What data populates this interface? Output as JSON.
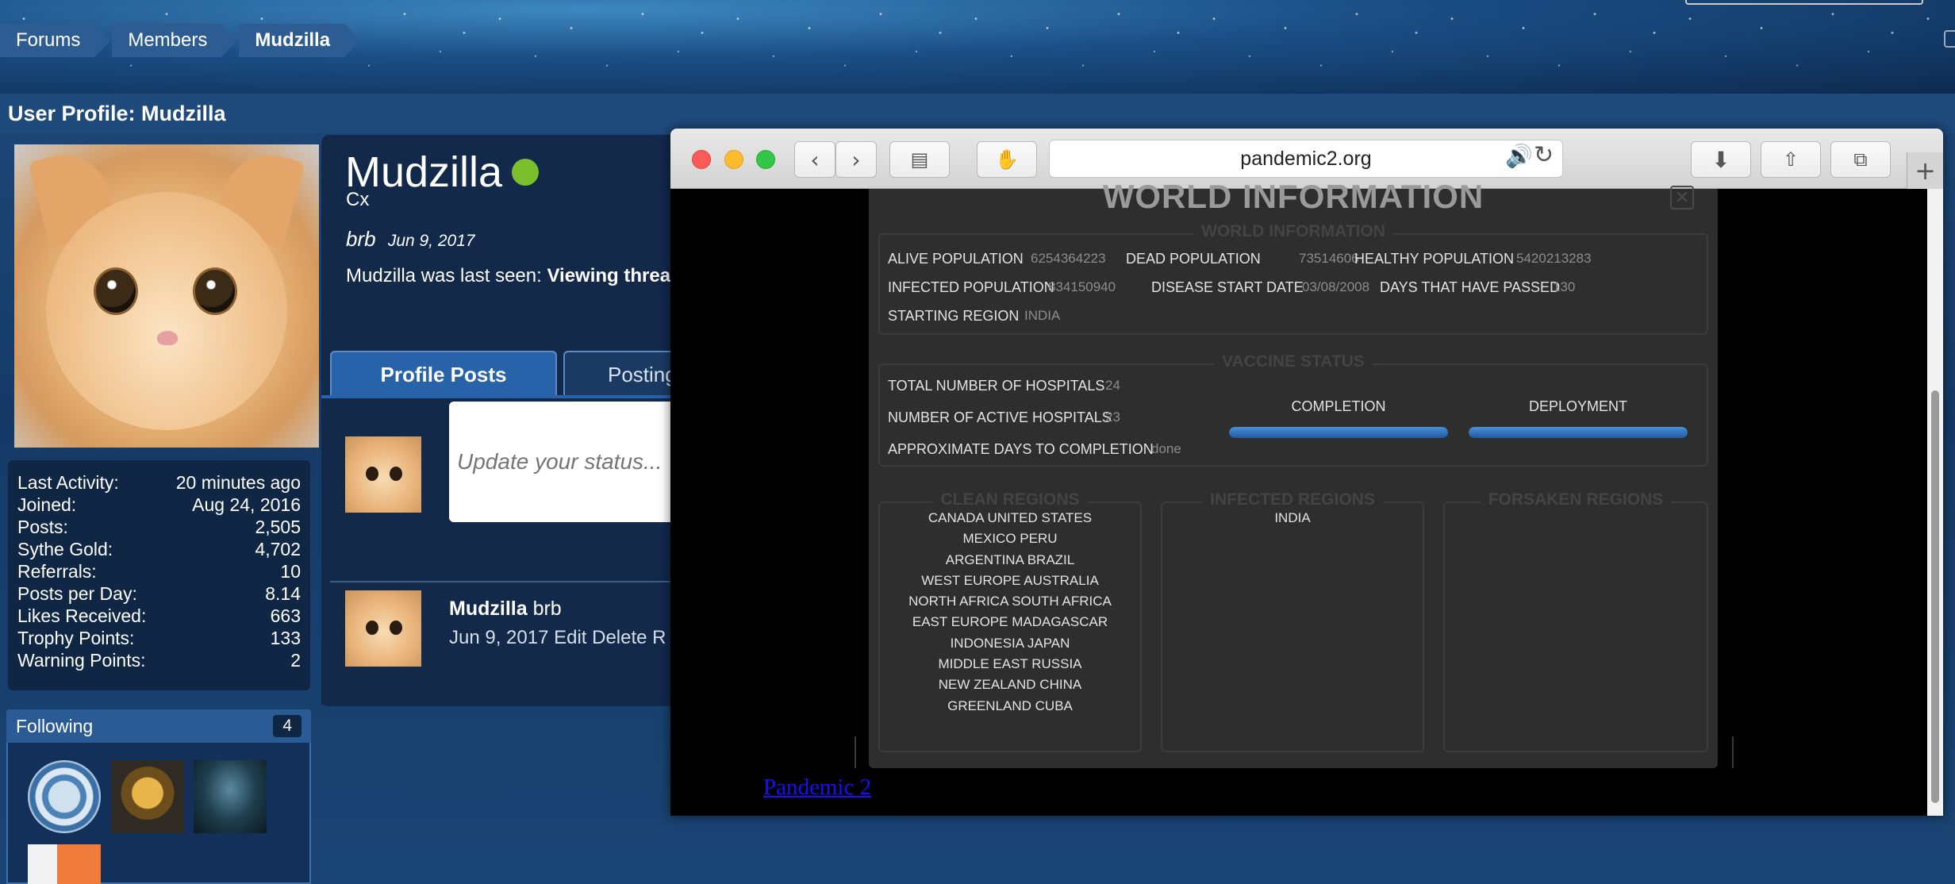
{
  "breadcrumb": [
    "Forums",
    "Members",
    "Mudzilla"
  ],
  "section_title": "User Profile: Mudzilla",
  "profile": {
    "username": "Mudzilla",
    "user_title": "Cx",
    "status_text": "brb",
    "status_date": "Jun 9, 2017",
    "last_seen_prefix": "Mudzilla was last seen:",
    "last_seen_value": "Viewing threa",
    "online_color": "#7cbf2d"
  },
  "stats": [
    {
      "label": "Last Activity:",
      "value": "20 minutes ago"
    },
    {
      "label": "Joined:",
      "value": "Aug 24, 2016"
    },
    {
      "label": "Posts:",
      "value": "2,505"
    },
    {
      "label": "Sythe Gold:",
      "value": "4,702"
    },
    {
      "label": "Referrals:",
      "value": "10"
    },
    {
      "label": "Posts per Day:",
      "value": "8.14"
    },
    {
      "label": "Likes Received:",
      "value": "663"
    },
    {
      "label": "Trophy Points:",
      "value": "133"
    },
    {
      "label": "Warning Points:",
      "value": "2"
    }
  ],
  "following": {
    "label": "Following",
    "count": "4"
  },
  "tabs": {
    "profile_posts": "Profile Posts",
    "postings": "Posting"
  },
  "status_input": {
    "placeholder": "Update your status..."
  },
  "post": {
    "author": "Mudzilla",
    "text": "brb",
    "meta": "Jun 9, 2017 Edit Delete R"
  },
  "browser": {
    "url": "pandemic2.org"
  },
  "game": {
    "title": "WORLD INFORMATION",
    "world_legend": "WORLD INFORMATION",
    "alive_label": "ALIVE POPULATION",
    "alive_value": "6254364223",
    "dead_label": "DEAD POPULATION",
    "dead_value": "73514606",
    "healthy_label": "HEALTHY POPULATION",
    "healthy_value": "5420213283",
    "infected_label": "INFECTED POPULATION",
    "infected_value": "834150940",
    "start_date_label": "DISEASE START DATE",
    "start_date_value": "03/08/2008",
    "days_label": "DAYS THAT HAVE PASSED",
    "days_value": "130",
    "region_label": "STARTING REGION",
    "region_value": "INDIA",
    "vaccine_legend": "VACCINE STATUS",
    "hospitals_label": "TOTAL NUMBER OF HOSPITALS",
    "hospitals_value": "24",
    "active_label": "NUMBER OF ACTIVE HOSPITALS",
    "active_value": "23",
    "approx_label": "APPROXIMATE DAYS TO COMPLETION",
    "approx_value": "done",
    "completion_label": "COMPLETION",
    "completion_fraction": 1.0,
    "deployment_label": "DEPLOYMENT",
    "deployment_fraction": 1.0,
    "clean_legend": "CLEAN REGIONS",
    "infected_legend": "INFECTED REGIONS",
    "forsaken_legend": "FORSAKEN REGIONS",
    "clean_regions": [
      "CANADA  UNITED STATES",
      "MEXICO  PERU",
      "ARGENTINA  BRAZIL",
      "WEST EUROPE  AUSTRALIA",
      "NORTH AFRICA  SOUTH AFRICA",
      "EAST EUROPE  MADAGASCAR",
      "INDONESIA  JAPAN",
      "MIDDLE EAST  RUSSIA",
      "NEW ZEALAND  CHINA",
      "GREENLAND  CUBA"
    ],
    "infected_regions": [
      "INDIA"
    ],
    "forsaken_regions": []
  },
  "page_link": "Pandemic 2",
  "colors": {
    "accent": "#2862a8",
    "panel": "#12294a",
    "progress": "#1f5ba5"
  }
}
